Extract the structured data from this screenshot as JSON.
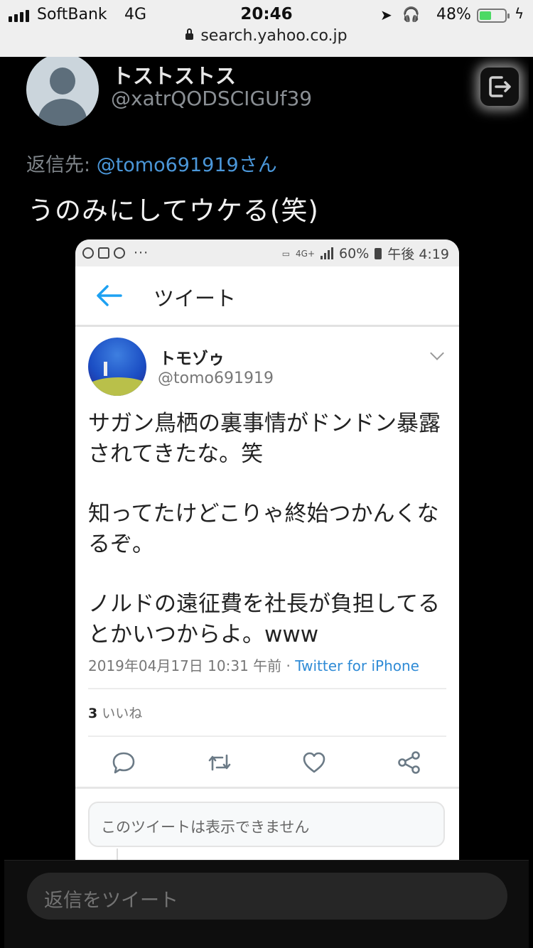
{
  "status_bar": {
    "carrier": "SoftBank",
    "network": "4G",
    "time": "20:46",
    "battery_percent": "48%",
    "battery_level": 0.48,
    "battery_color": "#4cd964"
  },
  "url_bar": {
    "url": "search.yahoo.co.jp"
  },
  "tweet": {
    "author_name": "トストストス",
    "author_handle": "@xatrQODSCIGUf39",
    "reply_prefix": "返信先:",
    "reply_mention": "@tomo691919さん",
    "text": "うのみにしてウケる(笑)",
    "share_icon": "share-out-icon"
  },
  "embedded_screenshot": {
    "status": {
      "network": "4G+",
      "battery": "60%",
      "time": "午後 4:19",
      "dots": "···"
    },
    "nav": {
      "back_icon": "back-arrow-icon",
      "title": "ツイート"
    },
    "quoted": {
      "name": "トモゾゥ",
      "handle": "@tomo691919",
      "line1": "サガン鳥栖の裏事情がドンドン暴露",
      "line2": "されてきたな。笑",
      "line3": "知ってたけどこりゃ終始つかんくな",
      "line4": "るぞ。",
      "line5": "ノルドの遠征費を社長が負担してる",
      "line6": "とかいつからよ。www",
      "timestamp": "2019年04月17日 10:31 午前 · ",
      "via": "Twitter for iPhone",
      "like_count": "3",
      "like_label": "いいね",
      "link_color": "#2f8bd6"
    },
    "unavailable_notice": "このツイートは表示できません"
  },
  "reply_bar": {
    "placeholder": "返信をツイート"
  }
}
